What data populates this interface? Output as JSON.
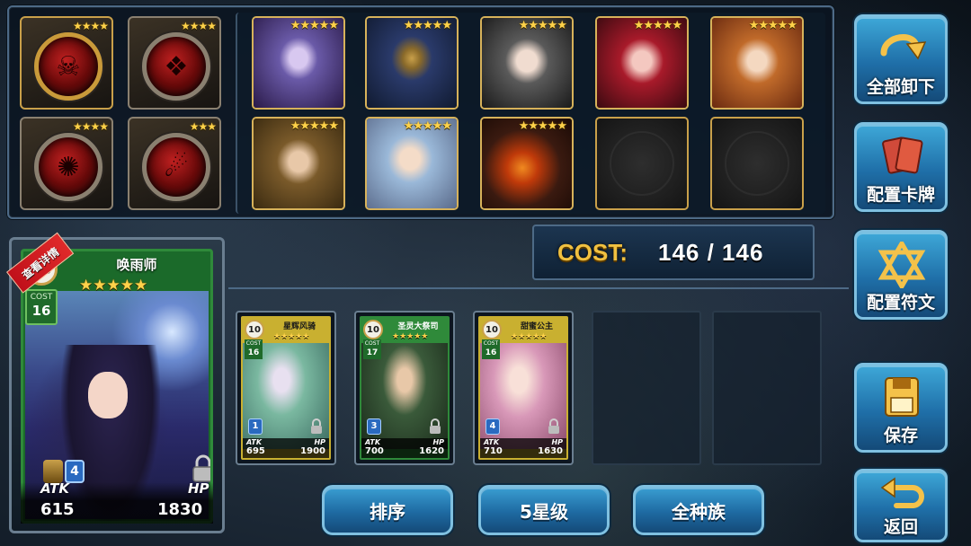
{
  "runes": [
    {
      "stars": "★★★★",
      "glyph": "☠",
      "frame": "gold"
    },
    {
      "stars": "★★★★",
      "glyph": "❖",
      "frame": "silver"
    },
    {
      "stars": "★★★★",
      "glyph": "✺",
      "frame": "silver"
    },
    {
      "stars": "★★★",
      "glyph": "☄",
      "frame": "silver"
    }
  ],
  "cards_row1": [
    {
      "stars": "★★★★★",
      "colors": [
        "#6a5aa8",
        "#d8c8f0",
        "#2a1a48"
      ]
    },
    {
      "stars": "★★★★★",
      "colors": [
        "#2a3a6a",
        "#c9a04a",
        "#101a30"
      ]
    },
    {
      "stars": "★★★★★",
      "colors": [
        "#5a5a5a",
        "#f0dcd0",
        "#1a1a1a"
      ]
    },
    {
      "stars": "★★★★★",
      "colors": [
        "#a81a2a",
        "#f4c8c0",
        "#3a0a10"
      ]
    },
    {
      "stars": "★★★★★",
      "colors": [
        "#c06a2a",
        "#f4d8c0",
        "#6a2a10"
      ]
    }
  ],
  "cards_row2": [
    {
      "stars": "★★★★★",
      "colors": [
        "#7a5a2a",
        "#e8c8a8",
        "#3a2a10"
      ]
    },
    {
      "stars": "★★★★★",
      "colors": [
        "#9ab8d8",
        "#f4dcc8",
        "#5a6a8a"
      ]
    },
    {
      "stars": "★★★★★",
      "colors": [
        "#c03a0a",
        "#3a1a10",
        "#f08a20"
      ]
    }
  ],
  "cost": {
    "label": "COST:",
    "value": "146  /  146"
  },
  "featured": {
    "title": "唤雨师",
    "level": "10",
    "cost_label": "COST",
    "cost_value": "16",
    "stars": "★★★★★",
    "ribbon": "查看详情",
    "badge": "4",
    "atk_label": "ATK",
    "hp_label": "HP",
    "atk": "615",
    "hp": "1830"
  },
  "deck": [
    {
      "name": "星辉风骑",
      "level": "10",
      "cost_label": "COST",
      "cost": "16",
      "stars": "★★★★★",
      "badge": "1",
      "atk_label": "ATK",
      "hp_label": "HP",
      "atk": "695",
      "hp": "1900",
      "frame": "#c9b030",
      "colors": [
        "#7ab8a0",
        "#e8e0f0",
        "#3a6a60"
      ]
    },
    {
      "name": "圣灵大祭司",
      "level": "10",
      "cost_label": "COST",
      "cost": "17",
      "stars": "★★★★★",
      "badge": "3",
      "atk_label": "ATK",
      "hp_label": "HP",
      "atk": "700",
      "hp": "1620",
      "frame": "#2f8a3a",
      "colors": [
        "#3a5a3a",
        "#e8c8a8",
        "#1a2a1a"
      ]
    },
    {
      "name": "甜蜜公主",
      "level": "10",
      "cost_label": "COST",
      "cost": "16",
      "stars": "★★★★★",
      "badge": "4",
      "atk_label": "ATK",
      "hp_label": "HP",
      "atk": "710",
      "hp": "1630",
      "frame": "#c9b030",
      "colors": [
        "#d898b8",
        "#f8e0d8",
        "#8a4a6a"
      ]
    }
  ],
  "side_buttons": {
    "unload_all": "全部卸下",
    "config_cards": "配置卡牌",
    "config_runes": "配置符文",
    "save": "保存",
    "back": "返回"
  },
  "bottom_buttons": {
    "sort": "排序",
    "star_filter": "5星级",
    "race_filter": "全种族"
  }
}
